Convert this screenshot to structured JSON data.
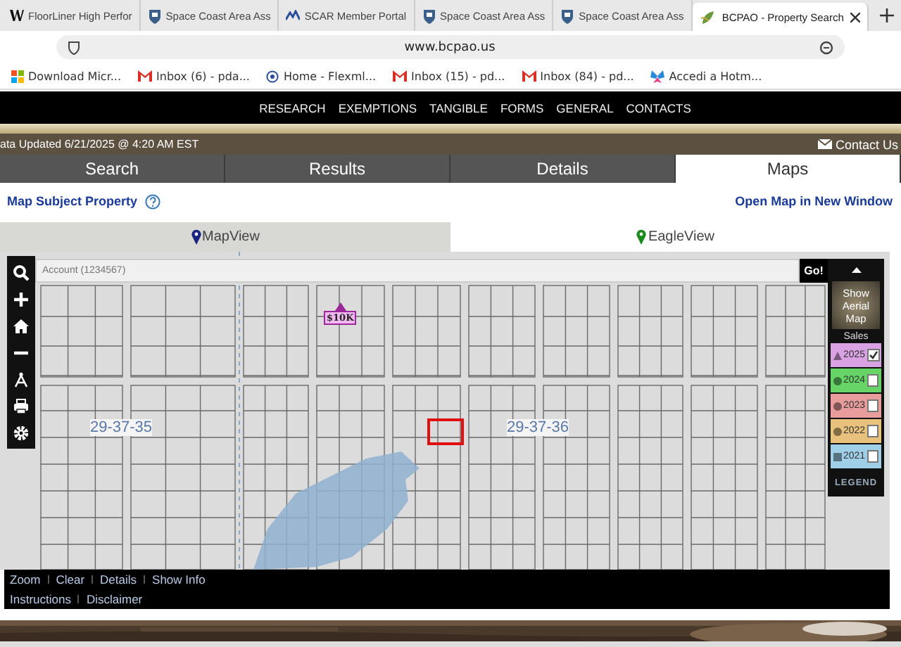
{
  "browser": {
    "tabs": [
      {
        "label": "FloorLiner High Perfor",
        "kind": "w",
        "selected": false
      },
      {
        "label": "Space Coast Area Ass",
        "kind": "shield",
        "selected": false
      },
      {
        "label": "SCAR Member Portal",
        "kind": "scar",
        "selected": false
      },
      {
        "label": "Space Coast Area Ass",
        "kind": "shield",
        "selected": false
      },
      {
        "label": "Space Coast Area Ass",
        "kind": "shield",
        "selected": false
      },
      {
        "label": "BCPAO - Property Search",
        "kind": "leaf",
        "selected": true
      }
    ],
    "url": "www.bcpao.us",
    "bookmarks": [
      {
        "label": "Download Micr...",
        "kind": "windows"
      },
      {
        "label": "Inbox (6) - pda...",
        "kind": "mail"
      },
      {
        "label": "Home - Flexml...",
        "kind": "pin"
      },
      {
        "label": "Inbox (15) - pd...",
        "kind": "mail"
      },
      {
        "label": "Inbox (84) - pd...",
        "kind": "mail"
      },
      {
        "label": "Accedi a Hotm...",
        "kind": "butterfly"
      }
    ]
  },
  "nav": [
    "RESEARCH",
    "EXEMPTIONS",
    "TANGIBLE",
    "FORMS",
    "GENERAL",
    "CONTACTS"
  ],
  "status_line": "ata Updated 6/21/2025 @ 4:20 AM EST",
  "contact_link": "Contact Us",
  "tabs": [
    {
      "label": "Search",
      "selected": false
    },
    {
      "label": "Results",
      "selected": false
    },
    {
      "label": "Details",
      "selected": false
    },
    {
      "label": "Maps",
      "selected": true
    }
  ],
  "links": {
    "left": "Map Subject Property",
    "right": "Open Map in New Window"
  },
  "view_tabs": [
    {
      "label": "MapView",
      "selected": true
    },
    {
      "label": "EagleView",
      "selected": false
    }
  ],
  "map": {
    "search": {
      "placeholder": "Account (1234567)"
    },
    "go_button": "Go!",
    "section_labels": [
      "29-37-35",
      "29-37-36"
    ],
    "sale_marker": "$10K",
    "legend": {
      "aerial_button": "Show Aerial Map",
      "title": "Sales",
      "footer": "LEGEND",
      "years": [
        {
          "year": "2025",
          "kind": "triangle",
          "color": "#d9a3e3",
          "checked": true
        },
        {
          "year": "2024",
          "kind": "circle",
          "color": "#66d466",
          "checked": false
        },
        {
          "year": "2023",
          "kind": "circle",
          "color": "#e89c9c",
          "checked": false
        },
        {
          "year": "2022",
          "kind": "circle",
          "color": "#e8c27c",
          "checked": false
        },
        {
          "year": "2021",
          "kind": "square",
          "color": "#9fd0e8",
          "checked": false
        }
      ]
    }
  },
  "footer": {
    "row_1": [
      "Zoom",
      "Clear",
      "Details",
      "Show Info"
    ],
    "row_2": [
      "Instructions",
      "Disclaimer"
    ]
  }
}
